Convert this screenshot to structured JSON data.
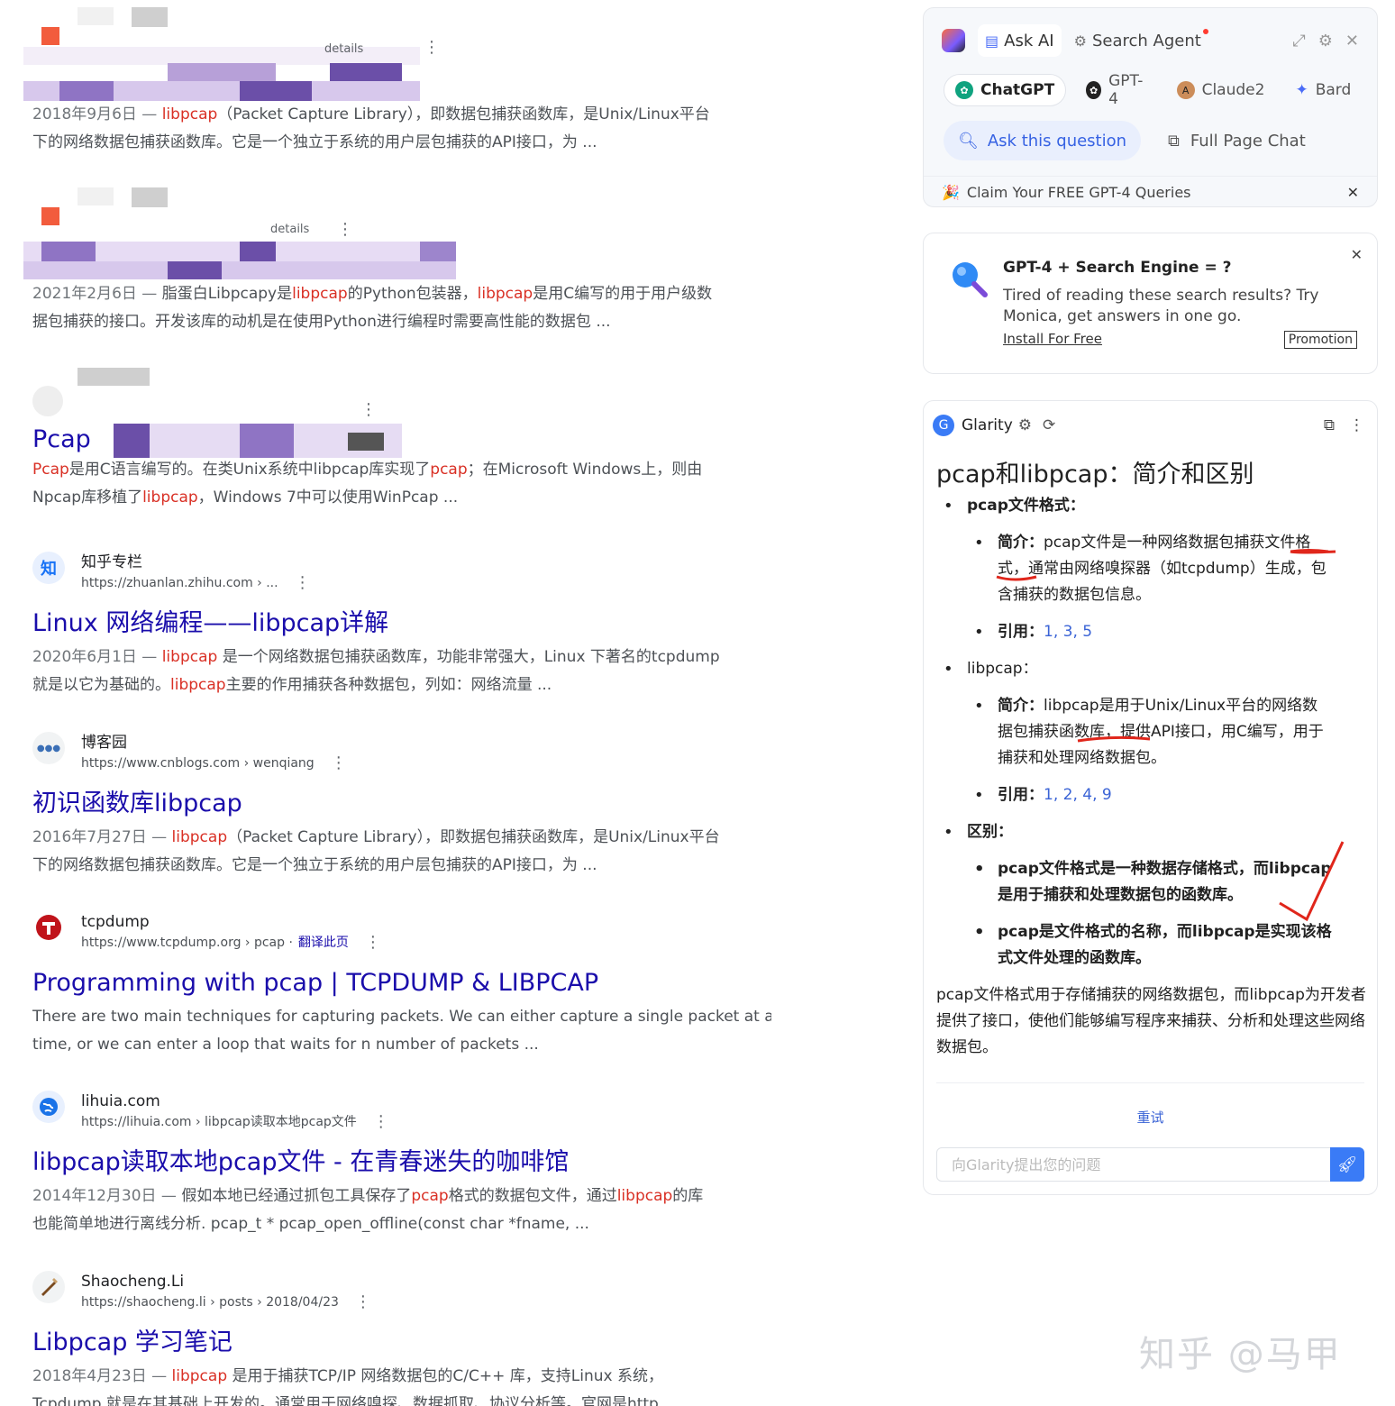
{
  "results": [
    {
      "site": "",
      "url": "",
      "title": "",
      "snippet_html": "<span class=\"date\">2018年9月6日 — </span><span class=\"hl\">libpcap</span>（Packet Capture Library），即数据包捕获函数库，是Unix/Linux平台<br>下的网络数据包捕获函数库。它是一个独立于系统的用户层包捕获的API接口，为 ..."
    },
    {
      "site": "",
      "url": "",
      "title": "",
      "snippet_html": "<span class=\"date\">2021年2月6日 — </span>脂蛋白Libpcapy是<span class=\"hl\">libpcap</span>的Python包装器，<span class=\"hl\">libpcap</span>是用C编写的用于用户级数<br>据包捕获的接口。开发该库的动机是在使用Python进行编程时需要高性能的数据包 ..."
    },
    {
      "site": "",
      "url": "",
      "title": "Pcap",
      "snippet_html": "<span class=\"hl\">Pcap</span>是用C语言编写的。在类Unix系统中libpcap库实现了<span class=\"hl\">pcap</span>；在Microsoft Windows上，则由<br>Npcap库移植了<span class=\"hl\">libpcap</span>，Windows 7中可以使用WinPcap ..."
    },
    {
      "site": "知乎专栏",
      "url": "https://zhuanlan.zhihu.com › ...",
      "title": "Linux 网络编程——libpcap详解",
      "snippet_html": "<span class=\"date\">2020年6月1日 — </span><span class=\"hl\">libpcap</span> 是一个网络数据包捕获函数库，功能非常强大，Linux 下著名的tcpdump<br>就是以它为基础的。<span class=\"hl\">libpcap</span>主要的作用捕获各种数据包，列如：网络流量 ..."
    },
    {
      "site": "博客园",
      "url": "https://www.cnblogs.com › wenqiang",
      "title": "初识函数库libpcap",
      "snippet_html": "<span class=\"date\">2016年7月27日 — </span><span class=\"hl\">libpcap</span>（Packet Capture Library），即数据包捕获函数库，是Unix/Linux平台<br>下的网络数据包捕获函数库。它是一个独立于系统的用户层包捕获的API接口，为 ..."
    },
    {
      "site": "tcpdump",
      "url": "https://www.tcpdump.org › pcap ·",
      "translate": "翻译此页",
      "title": "Programming with pcap | TCPDUMP & LIBPCAP",
      "snippet_html": "There are two main techniques for capturing packets. We can either capture a single packet at a<br>time, or we can enter a loop that waits for n number of packets ..."
    },
    {
      "site": "lihuia.com",
      "url": "https://lihuia.com › libpcap读取本地pcap文件",
      "title": "libpcap读取本地pcap文件 - 在青春迷失的咖啡馆",
      "snippet_html": "<span class=\"date\">2014年12月30日 — </span>假如本地已经通过抓包工具保存了<span class=\"hl\">pcap</span>格式的数据包文件，通过<span class=\"hl\">libpcap</span>的库<br>也能简单地进行离线分析. pcap_t * pcap_open_offline(const char *fname, ..."
    },
    {
      "site": "Shaocheng.Li",
      "url": "https://shaocheng.li › posts › 2018/04/23",
      "title": "Libpcap 学习笔记",
      "snippet_html": "<span class=\"date\">2018年4月23日 — </span><span class=\"hl\">libpcap</span> 是用于捕获TCP/IP 网络数据包的C/C++ 库，支持Linux 系统，<br>Tcpdump 就是在其基础上开发的。通常用于网络嗅探、数据抓取、协议分析等。官网是http ..."
    }
  ],
  "partial_labels": {
    "details_1": "details",
    "details_2": "details"
  },
  "monica": {
    "tabs": {
      "ask_ai": "Ask AI",
      "search_agent": "Search Agent"
    },
    "models": [
      "ChatGPT",
      "GPT-4",
      "Claude2",
      "Bard"
    ],
    "ask_question": "Ask this question",
    "full_page_chat": "Full Page Chat",
    "claim": "Claim Your FREE GPT-4 Queries"
  },
  "promo": {
    "title": "GPT-4 + Search Engine = ?",
    "body": "Tired of reading these search results? Try Monica, get answers in one go.",
    "install": "Install For Free",
    "tag": "Promotion"
  },
  "glarity": {
    "name": "Glarity",
    "heading": "pcap和libpcap：简介和区别",
    "pcap_label": "pcap文件格式：",
    "intro_label": "简介：",
    "pcap_intro": "pcap文件是一种网络数据包捕获文件格式，通常由网络嗅探器（如tcpdump）生成，包含捕获的数据包信息。",
    "ref_label": "引用：",
    "pcap_refs": "1, 3, 5",
    "libpcap_label": "libpcap：",
    "libpcap_intro": "libpcap是用于Unix/Linux平台的网络数据包捕获函数库，提供API接口，用C编写，用于捕获和处理网络数据包。",
    "libpcap_refs": "1, 2, 4, 9",
    "diff_label": "区别：",
    "diff_1": "pcap文件格式是一种数据存储格式，而libpcap是用于捕获和处理数据包的函数库。",
    "diff_2": "pcap是文件格式的名称，而libpcap是实现该格式文件处理的函数库。",
    "summary": "pcap文件格式用于存储捕获的网络数据包，而libpcap为开发者提供了接口，使他们能够编写程序来捕获、分析和处理这些网络数据包。",
    "retry": "重试",
    "input_placeholder": "向Glarity提出您的问题"
  },
  "watermark": "知乎 @马甲",
  "colors": {
    "link": "#1a0dab",
    "highlight": "#d93025",
    "accent": "#3a7bf6",
    "annotation": "#e0261b"
  }
}
